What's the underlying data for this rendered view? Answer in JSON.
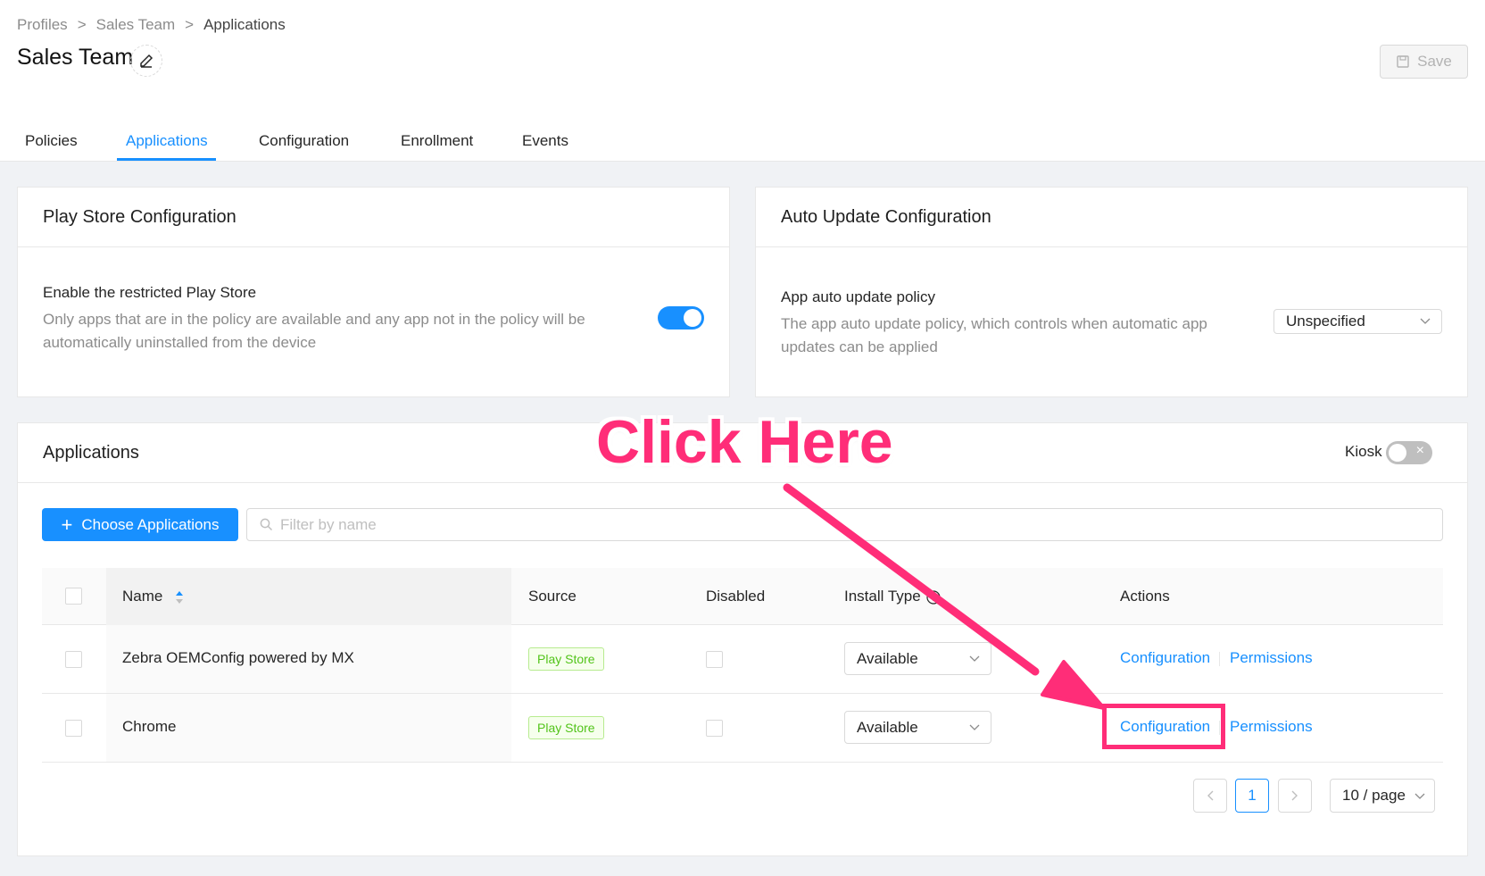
{
  "breadcrumb": {
    "items": [
      "Profiles",
      "Sales Team"
    ],
    "current": "Applications",
    "separator": ">"
  },
  "header": {
    "title": "Sales Team",
    "save_label": "Save"
  },
  "tabs": [
    {
      "label": "Policies"
    },
    {
      "label": "Applications",
      "active": true
    },
    {
      "label": "Configuration"
    },
    {
      "label": "Enrollment"
    },
    {
      "label": "Events"
    }
  ],
  "play_store": {
    "title": "Play Store Configuration",
    "setting_title": "Enable the restricted Play Store",
    "desc_line1": "Only apps that are in the policy are available and any app not in the policy will be",
    "desc_line2": "automatically uninstalled from the device",
    "enabled": true
  },
  "auto_update": {
    "title": "Auto Update Configuration",
    "setting_title": "App auto update policy",
    "desc_line1": "The app auto update policy, which controls when automatic app",
    "desc_line2": "updates can be applied",
    "selected": "Unspecified"
  },
  "applications": {
    "title": "Applications",
    "kiosk_label": "Kiosk",
    "kiosk_enabled": false,
    "choose_label": "Choose Applications",
    "filter_placeholder": "Filter by name",
    "columns": {
      "name": "Name",
      "source": "Source",
      "disabled": "Disabled",
      "install_type": "Install Type",
      "actions": "Actions"
    },
    "rows": [
      {
        "name": "Zebra OEMConfig powered by MX",
        "source": "Play Store",
        "install_type": "Available",
        "config": "Configuration",
        "permissions": "Permissions"
      },
      {
        "name": "Chrome",
        "source": "Play Store",
        "install_type": "Available",
        "config": "Configuration",
        "permissions": "Permissions"
      }
    ]
  },
  "pagination": {
    "current_page": "1",
    "page_size": "10 / page"
  },
  "annotation": {
    "text": "Click Here",
    "color": "#ff2d78"
  },
  "colors": {
    "accent": "#1890ff",
    "tag_green": "#52c41a"
  }
}
